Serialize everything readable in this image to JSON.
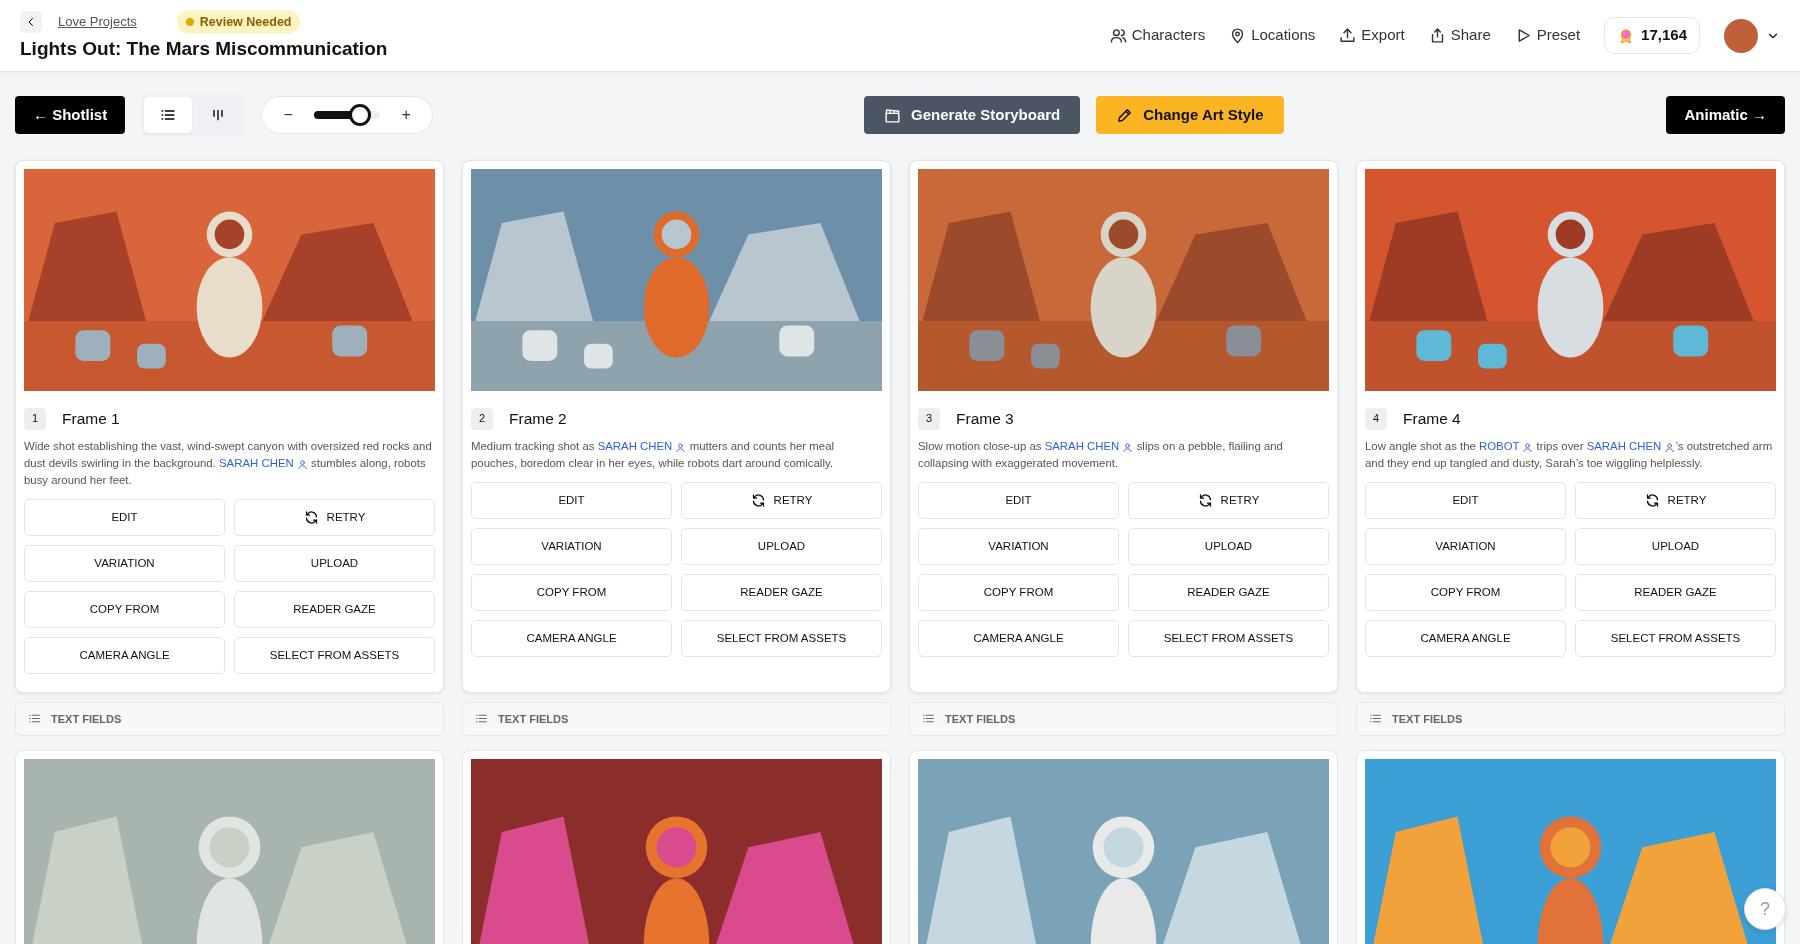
{
  "header": {
    "breadcrumb": "Love Projects",
    "status_badge": "Review Needed",
    "title": "Lights Out: The Mars Miscommunication",
    "nav": [
      {
        "kind": "characters",
        "label": "Characters"
      },
      {
        "kind": "locations",
        "label": "Locations"
      },
      {
        "kind": "export",
        "label": "Export"
      },
      {
        "kind": "share",
        "label": "Share"
      },
      {
        "kind": "preset",
        "label": "Preset"
      }
    ],
    "credits": "17,164"
  },
  "toolbar": {
    "back_button": "← Shotlist",
    "view_toggle": [
      {
        "kind": "list",
        "selected": true
      },
      {
        "kind": "board",
        "selected": false
      }
    ],
    "zoom": {
      "minus": "−",
      "plus": "+",
      "level": 0.7
    },
    "generate_button": "Generate Storyboard",
    "art_style_button": "Change Art Style",
    "next_button": "Animatic →"
  },
  "frames": [
    {
      "number": "1",
      "title": "Frame 1",
      "image": {
        "kind": "picture"
      },
      "description": [
        {
          "kind": "text",
          "text": "Wide shot establishing the vast, wind-swept canyon with oversized red rocks and dust devils swirling in the background. "
        },
        {
          "kind": "character",
          "text": "SARAH CHEN"
        },
        {
          "kind": "text",
          "text": " stumbles along, robots busy around her feet."
        }
      ],
      "actions": [
        {
          "kind": "plain",
          "label": "EDIT"
        },
        {
          "kind": "retry",
          "label": "RETRY"
        },
        {
          "kind": "plain",
          "label": "VARIATION"
        },
        {
          "kind": "plain",
          "label": "UPLOAD"
        },
        {
          "kind": "plain",
          "label": "COPY FROM"
        },
        {
          "kind": "plain",
          "label": "READER GAZE"
        },
        {
          "kind": "plain",
          "label": "CAMERA ANGLE"
        },
        {
          "kind": "plain",
          "label": "SELECT FROM ASSETS"
        }
      ],
      "text_fields": "TEXT FIELDS"
    },
    {
      "number": "2",
      "title": "Frame 2",
      "image": {
        "kind": "picture"
      },
      "description": [
        {
          "kind": "text",
          "text": "Medium tracking shot as "
        },
        {
          "kind": "character",
          "text": "SARAH CHEN"
        },
        {
          "kind": "text",
          "text": " mutters and counts her meal pouches, boredom clear in her eyes, while robots dart around comically."
        }
      ],
      "actions": [
        {
          "kind": "plain",
          "label": "EDIT"
        },
        {
          "kind": "retry",
          "label": "RETRY"
        },
        {
          "kind": "plain",
          "label": "VARIATION"
        },
        {
          "kind": "plain",
          "label": "UPLOAD"
        },
        {
          "kind": "plain",
          "label": "COPY FROM"
        },
        {
          "kind": "plain",
          "label": "READER GAZE"
        },
        {
          "kind": "plain",
          "label": "CAMERA ANGLE"
        },
        {
          "kind": "plain",
          "label": "SELECT FROM ASSETS"
        }
      ],
      "text_fields": "TEXT FIELDS"
    },
    {
      "number": "3",
      "title": "Frame 3",
      "image": {
        "kind": "picture"
      },
      "description": [
        {
          "kind": "text",
          "text": "Slow motion close-up as "
        },
        {
          "kind": "character",
          "text": "SARAH CHEN"
        },
        {
          "kind": "text",
          "text": " slips on a pebble, flailing and collapsing with exaggerated movement."
        }
      ],
      "actions": [
        {
          "kind": "plain",
          "label": "EDIT"
        },
        {
          "kind": "retry",
          "label": "RETRY"
        },
        {
          "kind": "plain",
          "label": "VARIATION"
        },
        {
          "kind": "plain",
          "label": "UPLOAD"
        },
        {
          "kind": "plain",
          "label": "COPY FROM"
        },
        {
          "kind": "plain",
          "label": "READER GAZE"
        },
        {
          "kind": "plain",
          "label": "CAMERA ANGLE"
        },
        {
          "kind": "plain",
          "label": "SELECT FROM ASSETS"
        }
      ],
      "text_fields": "TEXT FIELDS"
    },
    {
      "number": "4",
      "title": "Frame 4",
      "image": {
        "kind": "picture"
      },
      "description": [
        {
          "kind": "text",
          "text": "Low angle shot as the "
        },
        {
          "kind": "character",
          "text": "ROBOT"
        },
        {
          "kind": "text",
          "text": " trips over "
        },
        {
          "kind": "character",
          "text": "SARAH CHEN"
        },
        {
          "kind": "text",
          "text": "’s outstretched arm and they end up tangled and dusty, Sarah’s toe wiggling helplessly."
        }
      ],
      "actions": [
        {
          "kind": "plain",
          "label": "EDIT"
        },
        {
          "kind": "retry",
          "label": "RETRY"
        },
        {
          "kind": "plain",
          "label": "VARIATION"
        },
        {
          "kind": "plain",
          "label": "UPLOAD"
        },
        {
          "kind": "plain",
          "label": "COPY FROM"
        },
        {
          "kind": "plain",
          "label": "READER GAZE"
        },
        {
          "kind": "plain",
          "label": "CAMERA ANGLE"
        },
        {
          "kind": "plain",
          "label": "SELECT FROM ASSETS"
        }
      ],
      "text_fields": "TEXT FIELDS"
    },
    {
      "image": {
        "kind": "picture"
      }
    },
    {
      "image": {
        "kind": "picture"
      }
    },
    {
      "image": {
        "kind": "picture"
      }
    },
    {
      "image": {
        "kind": "picture"
      }
    }
  ],
  "help_button": "?"
}
